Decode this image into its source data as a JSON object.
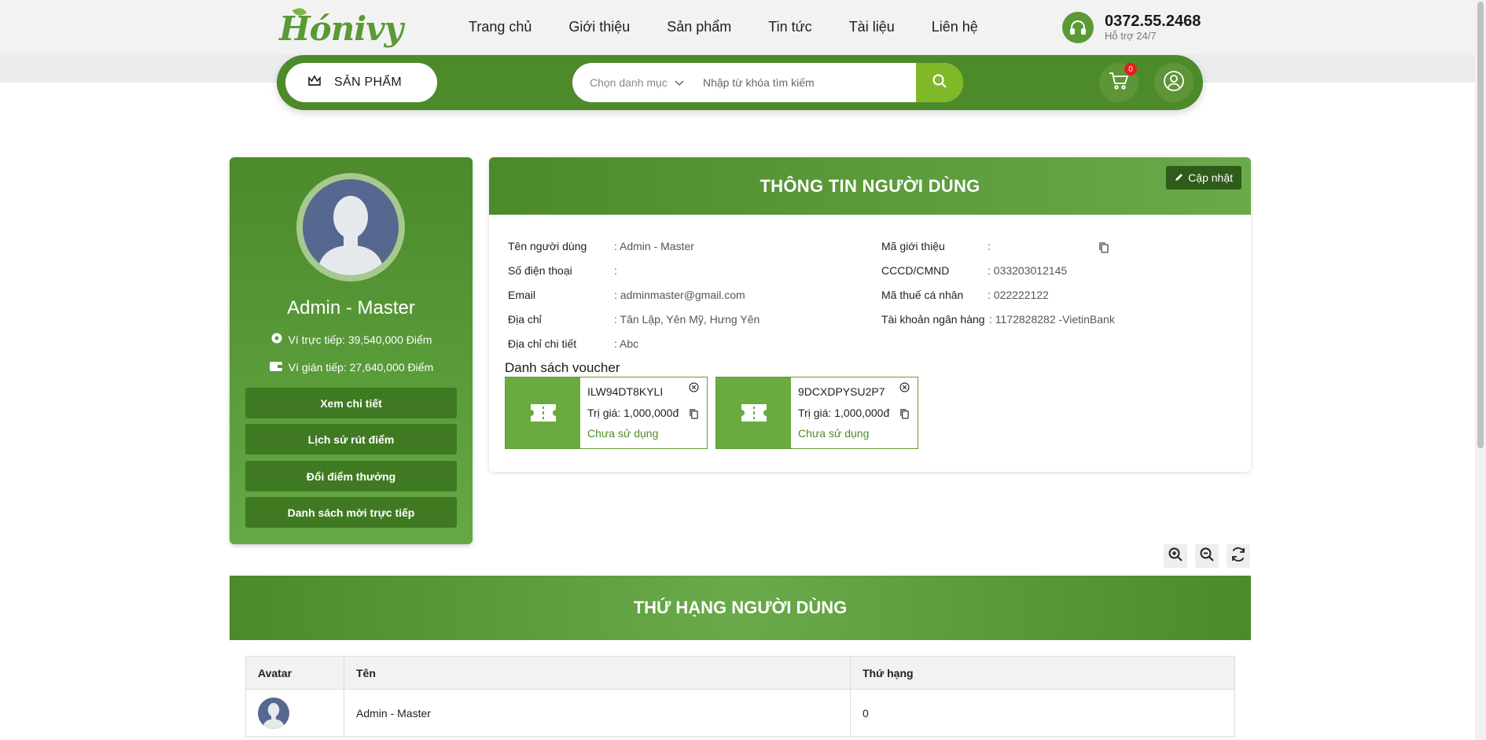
{
  "header": {
    "logo_text": "Hónivy",
    "nav": [
      "Trang chủ",
      "Giới thiệu",
      "Sản phẩm",
      "Tin tức",
      "Tài liệu",
      "Liên hệ"
    ],
    "hotline_number": "0372.55.2468",
    "hotline_sub": "Hỗ trợ 24/7"
  },
  "searchbar": {
    "products_label": "SẢN PHẨM",
    "category_placeholder": "Chọn danh mục",
    "search_placeholder": "Nhập từ khóa tìm kiếm",
    "cart_count": "0"
  },
  "profile": {
    "name": "Admin - Master",
    "wallet_direct": "Ví trực tiếp: 39,540,000 Điểm",
    "wallet_indirect": "Ví gián tiếp: 27,640,000 Điểm",
    "buttons": [
      "Xem chi tiết",
      "Lịch sử rút điểm",
      "Đổi điểm thưởng",
      "Danh sách mời trực tiếp"
    ]
  },
  "user_info": {
    "title": "THÔNG TIN NGƯỜI DÙNG",
    "update_label": "Cập nhật",
    "left_fields": [
      {
        "label": "Tên người dùng",
        "value": ": Admin - Master"
      },
      {
        "label": "Số điện thoại",
        "value": ":"
      },
      {
        "label": "Email",
        "value": ": adminmaster@gmail.com"
      },
      {
        "label": "Địa chỉ",
        "value": ": Tân Lập, Yên Mỹ, Hưng Yên"
      },
      {
        "label": "Địa chỉ chi tiết",
        "value": ": Abc"
      }
    ],
    "right_fields": [
      {
        "label": "Mã giới thiệu",
        "value": ":"
      },
      {
        "label": "CCCD/CMND",
        "value": ": 033203012145"
      },
      {
        "label": "Mã thuế cá nhân",
        "value": ": 022222122"
      },
      {
        "label": "Tài khoản ngân hàng",
        "value": ": 1172828282 -VietinBank"
      }
    ],
    "voucher_title": "Danh sách voucher",
    "vouchers": [
      {
        "code": "ILW94DT8KYLI",
        "value": "Trị giá: 1,000,000đ",
        "status": "Chưa sử dụng"
      },
      {
        "code": "9DCXDPYSU2P7",
        "value": "Trị giá: 1,000,000đ",
        "status": "Chưa sử dụng"
      }
    ]
  },
  "ranking": {
    "title": "THỨ HẠNG NGƯỜI DÙNG",
    "columns": [
      "Avatar",
      "Tên",
      "Thứ hạng"
    ],
    "rows": [
      {
        "name": "Admin - Master",
        "rank": "0"
      }
    ]
  },
  "colors": {
    "brand_green": "#4d8a2a",
    "accent_lime": "#7fb928",
    "badge_red": "#e61e1e"
  }
}
